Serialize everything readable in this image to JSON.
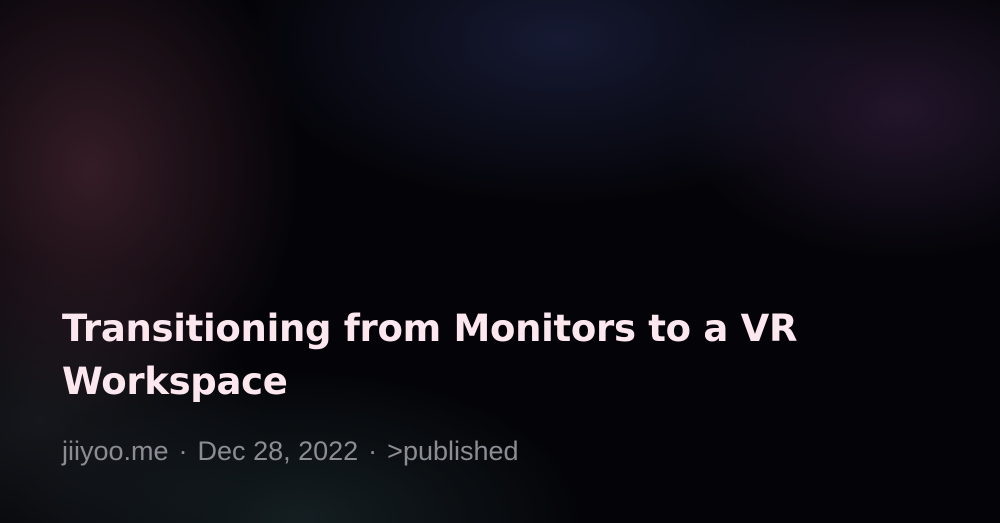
{
  "post": {
    "title": "Transitioning from Monitors to a VR Workspace",
    "site": "jiiyoo.me",
    "date": "Dec 28, 2022",
    "tag": ">published",
    "separator": "·"
  },
  "colors": {
    "title": "#fce7ef",
    "meta": "#8c8c94",
    "background": "#040408"
  }
}
